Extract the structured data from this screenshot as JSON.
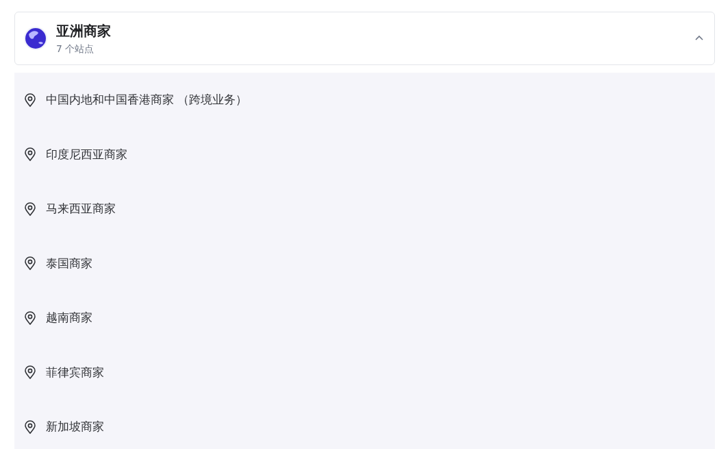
{
  "region": {
    "title": "亚洲商家",
    "subtitle": "7 个站点",
    "expanded": true
  },
  "sites": [
    {
      "label": "中国内地和中国香港商家 （跨境业务）"
    },
    {
      "label": "印度尼西亚商家"
    },
    {
      "label": "马来西亚商家"
    },
    {
      "label": "泰国商家"
    },
    {
      "label": "越南商家"
    },
    {
      "label": "菲律宾商家"
    },
    {
      "label": "新加坡商家"
    }
  ]
}
